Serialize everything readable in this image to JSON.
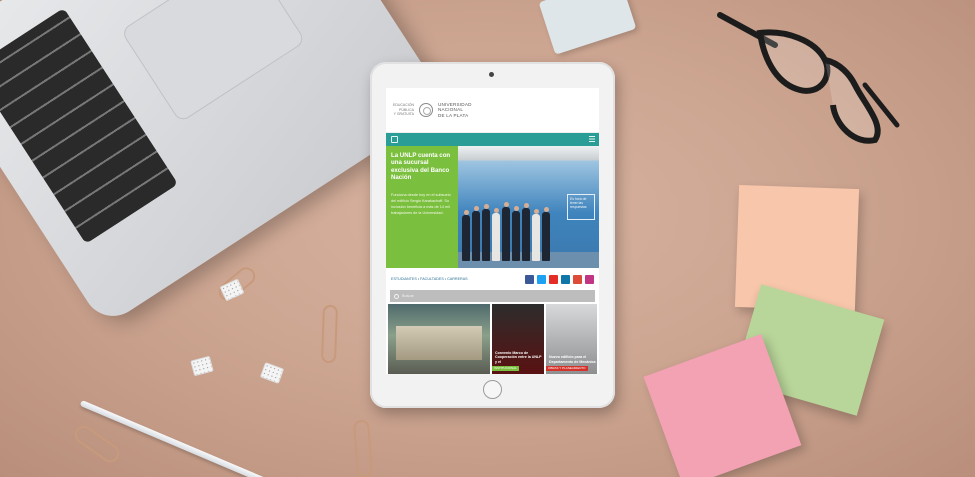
{
  "header": {
    "edu_line1": "EDUCACIÓN",
    "edu_line2": "PÚBLICA",
    "edu_line3": "Y GRATUITA",
    "uni_line1": "UNIVERSIDAD",
    "uni_line2": "NACIONAL",
    "uni_line3": "DE LA PLATA"
  },
  "hero": {
    "title": "La UNLP cuenta con una sucursal exclusiva del Banco Nación",
    "body": "Funciona desde hoy en el subsuelo del edificio Sergio Karakachoff. Su inclusión beneficia a más de 14 mil trabajadores de la Universidad.",
    "sign_line1": "Es hora de",
    "sign_line2": "tener las",
    "sign_line3": "respuestas"
  },
  "links": {
    "crumbs": "ESTUDIANTES • FACULTADES • CARRERAS"
  },
  "search": {
    "placeholder": "Buscar"
  },
  "news": [
    {
      "title": "",
      "tag": ""
    },
    {
      "title": "Convenio Marco de Cooperación entre la UNLP y el",
      "tag": "INSTITUCIONAL"
    },
    {
      "title": "Nuevo edificio para el Departamento de Mecánica",
      "tag": "OBRAS Y PLANEAMIENTO"
    }
  ],
  "colors": {
    "teal_nav": "#2a9d97",
    "hero_green": "#7bbf3e",
    "facebook": "#3b5998",
    "twitter": "#1da1f2",
    "youtube": "#e52d27",
    "linkedin": "#0e76a8",
    "googleplus": "#dd4b39",
    "instagram": "#c13584"
  },
  "icons": [
    "menu-icon",
    "hamburger-icon",
    "facebook-icon",
    "twitter-icon",
    "youtube-icon",
    "linkedin-icon",
    "googleplus-icon",
    "instagram-icon",
    "search-icon"
  ]
}
